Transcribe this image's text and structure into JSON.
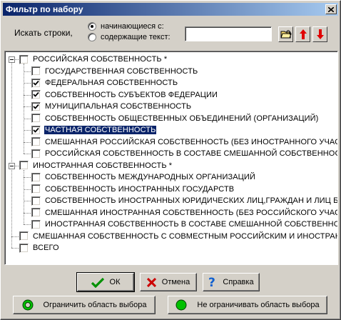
{
  "window": {
    "title": "Фильтр по набору"
  },
  "search": {
    "label": "Искать строки,",
    "option_starts": "начинающиеся с:",
    "option_contains": "содержащие текст:",
    "selected_option": "starts",
    "value": ""
  },
  "tree": {
    "items": [
      {
        "label": "РОССИЙСКАЯ СОБСТВЕННОСТЬ *",
        "level": 0,
        "checked": false,
        "expander": "minus"
      },
      {
        "label": "ГОСУДАРСТВЕННАЯ СОБСТВЕННОСТЬ",
        "level": 1,
        "checked": false
      },
      {
        "label": "ФЕДЕРАЛЬНАЯ СОБСТВЕННОСТЬ",
        "level": 1,
        "checked": true
      },
      {
        "label": "СОБСТВЕННОСТЬ СУБЪЕКТОВ ФЕДЕРАЦИИ",
        "level": 1,
        "checked": true
      },
      {
        "label": "МУНИЦИПАЛЬНАЯ  СОБСТВЕННОСТЬ",
        "level": 1,
        "checked": true
      },
      {
        "label": "СОБСТВЕННОСТЬ ОБЩЕСТВЕННЫХ ОБЪЕДИНЕНИЙ (ОРГАНИЗАЦИЙ)",
        "level": 1,
        "checked": false
      },
      {
        "label": "ЧАСТНАЯ СОБСТВЕННОСТЬ",
        "level": 1,
        "checked": true,
        "selected": true
      },
      {
        "label": "СМЕШАННАЯ РОССИЙСКАЯ СОБСТВЕННОСТЬ (БЕЗ ИНОСТРАННОГО УЧАСТИ",
        "level": 1,
        "checked": false
      },
      {
        "label": "РОССИЙСКАЯ СОБСТВЕННОСТЬ В СОСТАВЕ СМЕШАННОЙ СОБСТВЕННОСТИ",
        "level": 1,
        "checked": false
      },
      {
        "label": "ИНОСТРАННАЯ СОБСТВЕННОСТЬ *",
        "level": 0,
        "checked": false,
        "expander": "minus"
      },
      {
        "label": "СОБСТВЕННОСТЬ МЕЖДУНАРОДНЫХ ОРГАНИЗАЦИЙ",
        "level": 1,
        "checked": false
      },
      {
        "label": "СОБСТВЕННОСТЬ ИНОСТРАННЫХ ГОСУДАРСТВ",
        "level": 1,
        "checked": false
      },
      {
        "label": "СОБСТВЕННОСТЬ ИНОСТРАННЫХ ЮРИДИЧЕСКИХ ЛИЦ,ГРАЖДАН И ЛИЦ БЕ",
        "level": 1,
        "checked": false
      },
      {
        "label": "СМЕШАННАЯ ИНОСТРАННАЯ СОБСТВЕННОСТЬ (БЕЗ РОССИЙСКОГО УЧАСТИ",
        "level": 1,
        "checked": false
      },
      {
        "label": "ИНОСТРАННАЯ СОБСТВЕННОСТЬ В СОСТАВЕ СМЕШАННОЙ СОБСТВЕННОСТ",
        "level": 1,
        "checked": false
      },
      {
        "label": "СМЕШАННАЯ СОБСТВЕННОСТЬ С СОВМЕСТНЫМ РОССИЙСКИМ И ИНОСТРАННЫ",
        "level": 0,
        "checked": false
      },
      {
        "label": "ВСЕГО",
        "level": 0,
        "checked": false
      }
    ]
  },
  "buttons": {
    "ok": "ОК",
    "cancel": "Отмена",
    "help": "Справка",
    "limit": "Ограничить область выбора",
    "no_limit": "Не ограничивать область выбора"
  },
  "colors": {
    "title_start": "#0a246a",
    "title_end": "#a6caf0",
    "selection": "#0a246a",
    "arrow_red": "#e00000",
    "light_green": "#00c000"
  }
}
